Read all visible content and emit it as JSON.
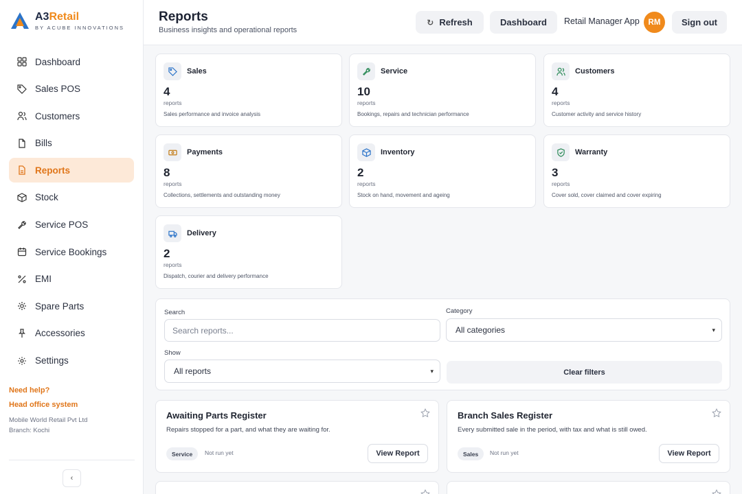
{
  "brand": {
    "name_a": "A3",
    "name_b": "Retail",
    "tagline": "BY ACUBE INNOVATIONS"
  },
  "sidebar": {
    "items": [
      {
        "label": "Dashboard",
        "icon": "grid-icon"
      },
      {
        "label": "Sales POS",
        "icon": "tag-icon"
      },
      {
        "label": "Customers",
        "icon": "users-icon"
      },
      {
        "label": "Bills",
        "icon": "document-icon"
      },
      {
        "label": "Reports",
        "icon": "reports-icon",
        "active": true
      },
      {
        "label": "Stock",
        "icon": "box-icon"
      },
      {
        "label": "Service POS",
        "icon": "wrench-icon"
      },
      {
        "label": "Service Bookings",
        "icon": "calendar-icon"
      },
      {
        "label": "EMI",
        "icon": "percent-icon"
      },
      {
        "label": "Spare Parts",
        "icon": "gear-icon"
      },
      {
        "label": "Accessories",
        "icon": "pin-icon"
      },
      {
        "label": "Settings",
        "icon": "settings-icon"
      }
    ],
    "need_help": "Need help?",
    "head_office": "Head office system",
    "company": "Mobile World Retail Pvt Ltd",
    "branch": "Branch: Kochi",
    "collapse": "‹"
  },
  "header": {
    "title": "Reports",
    "subtitle": "Business insights and operational reports",
    "refresh": "Refresh",
    "dashboard": "Dashboard",
    "app": "Retail Manager App",
    "avatar": "RM",
    "signout": "Sign out"
  },
  "categories": [
    {
      "title": "Sales",
      "count": "4",
      "unit": "reports",
      "desc": "Sales performance and invoice analysis",
      "icon": "tag-icon"
    },
    {
      "title": "Service",
      "count": "10",
      "unit": "reports",
      "desc": "Bookings, repairs and technician performance",
      "icon": "wrench-icon"
    },
    {
      "title": "Customers",
      "count": "4",
      "unit": "reports",
      "desc": "Customer activity and service history",
      "icon": "users-icon"
    },
    {
      "title": "Payments",
      "count": "8",
      "unit": "reports",
      "desc": "Collections, settlements and outstanding money",
      "icon": "cash-icon"
    },
    {
      "title": "Inventory",
      "count": "2",
      "unit": "reports",
      "desc": "Stock on hand, movement and ageing",
      "icon": "box-icon"
    },
    {
      "title": "Warranty",
      "count": "3",
      "unit": "reports",
      "desc": "Cover sold, cover claimed and cover expiring",
      "icon": "shield-icon"
    },
    {
      "title": "Delivery",
      "count": "2",
      "unit": "reports",
      "desc": "Dispatch, courier and delivery performance",
      "icon": "truck-icon"
    }
  ],
  "filters": {
    "search_label": "Search",
    "search_placeholder": "Search reports...",
    "category_label": "Category",
    "category_value": "All categories",
    "show_label": "Show",
    "show_value": "All reports",
    "clear": "Clear filters"
  },
  "reports": [
    {
      "title": "Awaiting Parts Register",
      "desc": "Repairs stopped for a part, and what they are waiting for.",
      "badge": "Service",
      "status": "Not run yet",
      "action": "View Report"
    },
    {
      "title": "Branch Sales Register",
      "desc": "Every submitted sale in the period, with tax and what is still owed.",
      "badge": "Sales",
      "status": "Not run yet",
      "action": "View Report"
    }
  ],
  "colors": {
    "accent": "#f08a1c",
    "active_bg": "#fde9d8"
  }
}
